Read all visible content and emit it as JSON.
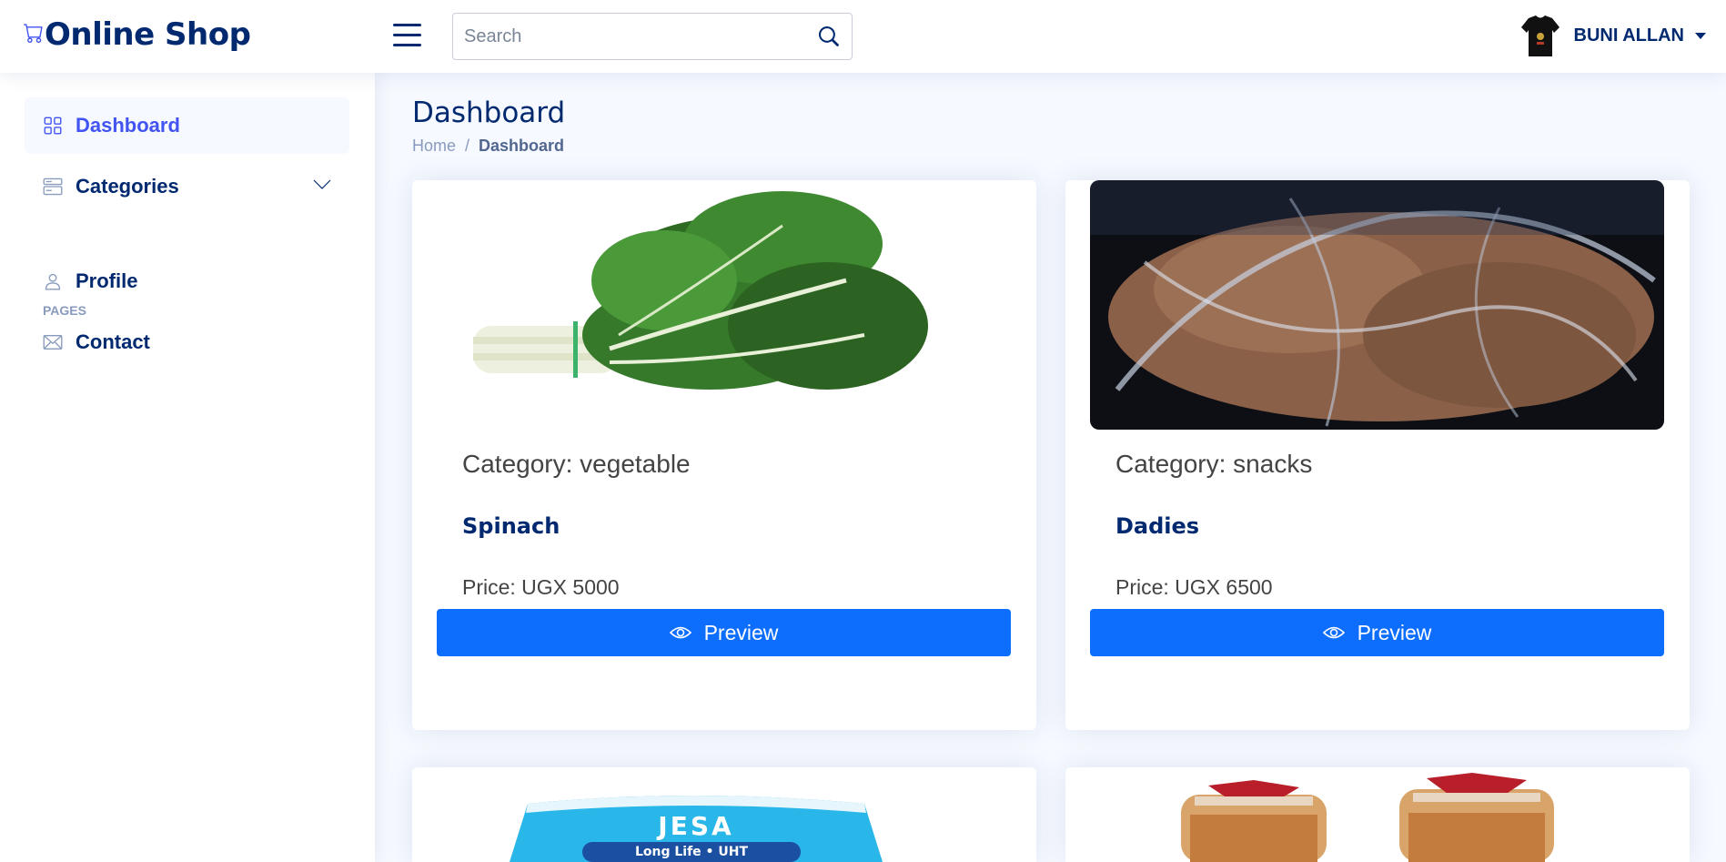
{
  "header": {
    "brand": "Online Shop",
    "search_placeholder": "Search",
    "user_name": "BUNI ALLAN"
  },
  "sidebar": {
    "items": [
      {
        "label": "Dashboard",
        "icon": "grid-icon",
        "active": true
      },
      {
        "label": "Categories",
        "icon": "layout-icon",
        "expandable": true
      }
    ],
    "pages_heading": "PAGES",
    "pages": [
      {
        "label": "Profile",
        "icon": "person-icon"
      },
      {
        "label": "Contact",
        "icon": "envelope-icon"
      }
    ]
  },
  "page": {
    "title": "Dashboard",
    "breadcrumb": [
      "Home",
      "Dashboard"
    ]
  },
  "products": [
    {
      "category": "Category: vegetable",
      "name": "Spinach",
      "price": "Price: UGX 5000",
      "button": "Preview"
    },
    {
      "category": "Category: snacks",
      "name": "Dadies",
      "price": "Price: UGX 6500",
      "button": "Preview"
    }
  ],
  "partial_products": [
    {
      "image_text_1": "JESA",
      "image_text_2": "Long Life • UHT"
    }
  ],
  "colors": {
    "brand": "#012970",
    "accent": "#4154f1",
    "button": "#0d6efd",
    "background": "#f6f9ff"
  }
}
